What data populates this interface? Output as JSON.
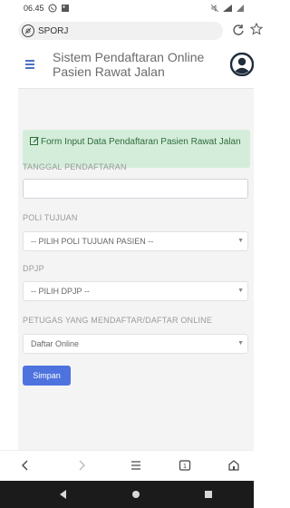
{
  "status_bar": {
    "time": "06.45"
  },
  "browser": {
    "url": "SPORJ"
  },
  "header": {
    "title": "Sistem Pendaftaran Online Pasien Rawat Jalan"
  },
  "form": {
    "alert_text": "Form Input Data Pendaftaran Pasien Rawat Jalan",
    "tanggal_label": "TANGGAL PENDAFTARAN",
    "tanggal_value": "",
    "poli_label": "POLI TUJUAN",
    "poli_selected": "-- PILIH POLI TUJUAN PASIEN --",
    "dpjp_label": "DPJP",
    "dpjp_selected": "-- PILIH DPJP --",
    "petugas_label": "PETUGAS YANG MENDAFTAR/DAFTAR ONLINE",
    "petugas_selected": "Daftar Online",
    "save_label": "Simpan"
  },
  "colors": {
    "accent": "#4e73df",
    "alert_bg": "#d4edda",
    "alert_text": "#2e6b3a",
    "android_nav": "#1b1b1b"
  },
  "icons": {
    "status_whatsapp": "whatsapp-icon",
    "status_image": "image-icon",
    "url_site": "lock-icon",
    "reload": "reload-icon",
    "bookmark": "star-icon",
    "menu": "hamburger-icon",
    "user": "user-avatar-icon",
    "alert": "edit-icon",
    "back": "chevron-left-icon",
    "forward": "chevron-right-icon",
    "menu_bottom": "menu-lines-icon",
    "tabs": "tabs-icon",
    "home": "home-icon"
  }
}
